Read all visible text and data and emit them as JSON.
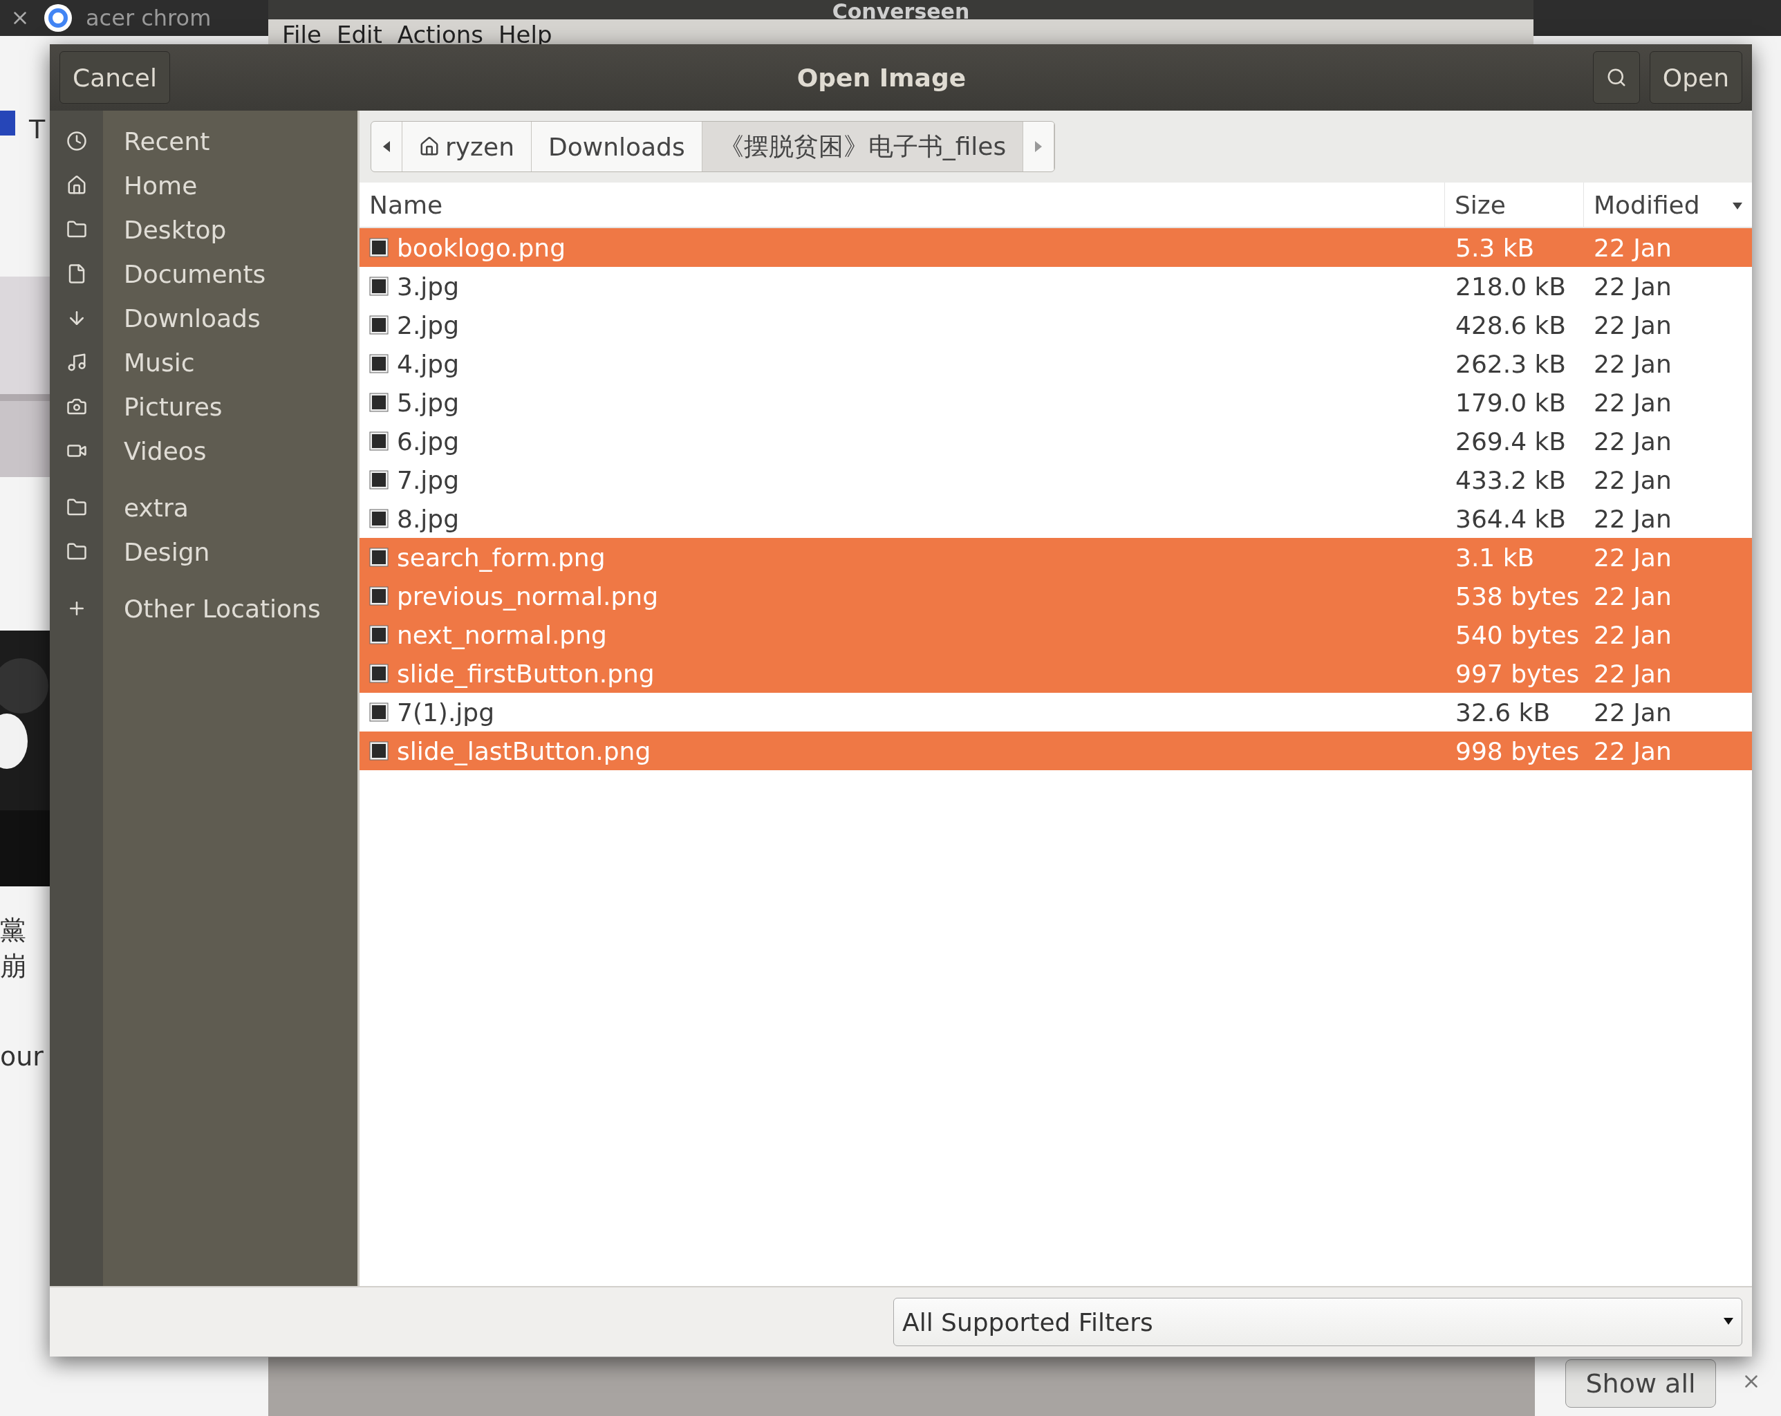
{
  "background": {
    "tab_title": "acer chrom",
    "app_title": "Converseen",
    "menu": [
      "File",
      "Edit",
      "Actions",
      "Help"
    ],
    "page_texts": [
      "T",
      "黨",
      "崩",
      "our"
    ],
    "show_all": "Show all"
  },
  "dialog": {
    "cancel": "Cancel",
    "title": "Open Image",
    "open": "Open",
    "sections": [
      {
        "items": [
          {
            "label": "Recent",
            "kind": "recent"
          },
          {
            "label": "Home",
            "kind": "home"
          },
          {
            "label": "Desktop",
            "kind": "folder"
          },
          {
            "label": "Documents",
            "kind": "document"
          },
          {
            "label": "Downloads",
            "kind": "download"
          },
          {
            "label": "Music",
            "kind": "music"
          },
          {
            "label": "Pictures",
            "kind": "camera"
          },
          {
            "label": "Videos",
            "kind": "video"
          }
        ]
      },
      {
        "items": [
          {
            "label": "extra",
            "kind": "folder"
          },
          {
            "label": "Design",
            "kind": "folder"
          }
        ]
      },
      {
        "items": [
          {
            "label": "Other Locations",
            "kind": "plus"
          }
        ]
      }
    ],
    "path": [
      {
        "label": "ryzen",
        "home": true,
        "selected": false
      },
      {
        "label": "Downloads",
        "home": false,
        "selected": false
      },
      {
        "label": "《摆脱贫困》电子书_files",
        "home": false,
        "selected": true
      }
    ],
    "columns": [
      "Name",
      "Size",
      "Modified"
    ],
    "files": [
      {
        "name": "booklogo.png",
        "size": "5.3 kB",
        "modified": "22 Jan",
        "selected": true
      },
      {
        "name": "3.jpg",
        "size": "218.0 kB",
        "modified": "22 Jan",
        "selected": false
      },
      {
        "name": "2.jpg",
        "size": "428.6 kB",
        "modified": "22 Jan",
        "selected": false
      },
      {
        "name": "4.jpg",
        "size": "262.3 kB",
        "modified": "22 Jan",
        "selected": false
      },
      {
        "name": "5.jpg",
        "size": "179.0 kB",
        "modified": "22 Jan",
        "selected": false
      },
      {
        "name": "6.jpg",
        "size": "269.4 kB",
        "modified": "22 Jan",
        "selected": false
      },
      {
        "name": "7.jpg",
        "size": "433.2 kB",
        "modified": "22 Jan",
        "selected": false
      },
      {
        "name": "8.jpg",
        "size": "364.4 kB",
        "modified": "22 Jan",
        "selected": false
      },
      {
        "name": "search_form.png",
        "size": "3.1 kB",
        "modified": "22 Jan",
        "selected": true
      },
      {
        "name": "previous_normal.png",
        "size": "538 bytes",
        "modified": "22 Jan",
        "selected": true
      },
      {
        "name": "next_normal.png",
        "size": "540 bytes",
        "modified": "22 Jan",
        "selected": true
      },
      {
        "name": "slide_firstButton.png",
        "size": "997 bytes",
        "modified": "22 Jan",
        "selected": true
      },
      {
        "name": "7(1).jpg",
        "size": "32.6 kB",
        "modified": "22 Jan",
        "selected": false
      },
      {
        "name": "slide_lastButton.png",
        "size": "998 bytes",
        "modified": "22 Jan",
        "selected": true
      }
    ],
    "filter": "All Supported Filters"
  }
}
